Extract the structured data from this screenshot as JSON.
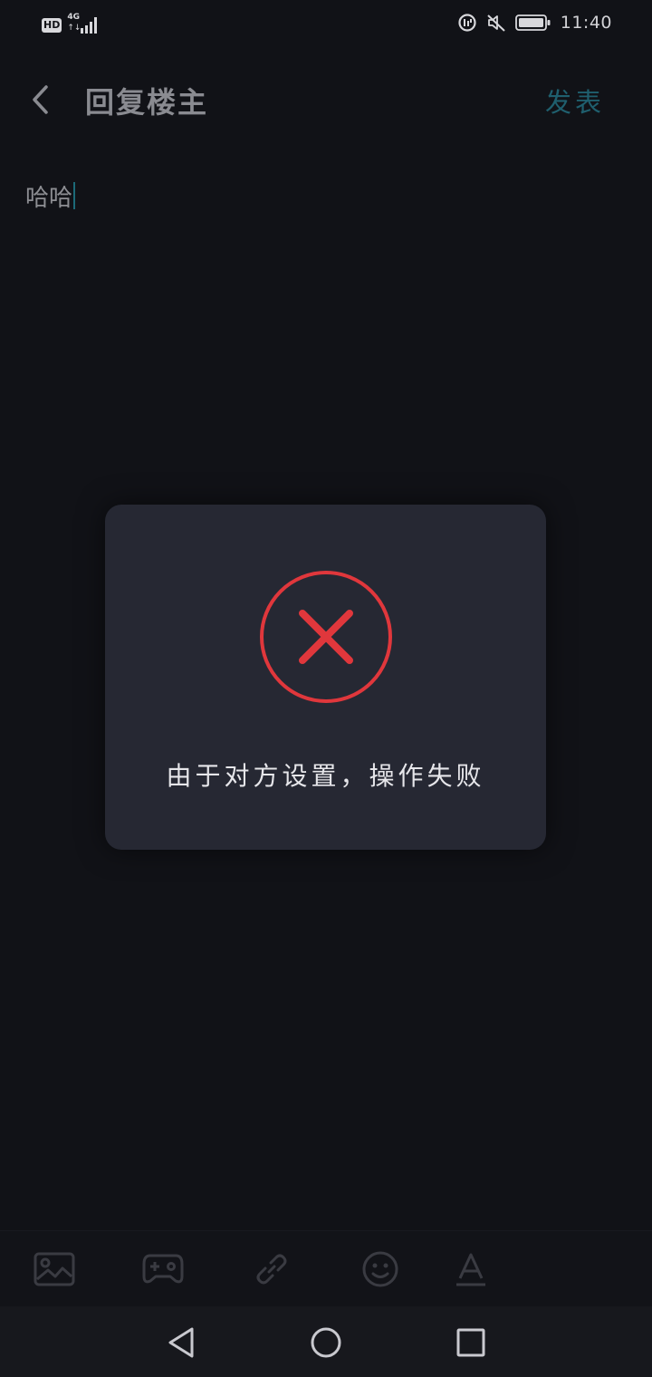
{
  "status_bar": {
    "hd": "HD",
    "network": "4G",
    "network_arrows": "↑↓",
    "time": "11:40",
    "icons": [
      "hd-icon",
      "signal-4g-icon",
      "data-saver-icon",
      "mute-icon",
      "battery-icon"
    ]
  },
  "header": {
    "title": "回复楼主",
    "publish_label": "发表",
    "back_icon": "chevron-left-icon"
  },
  "editor": {
    "text": "哈哈"
  },
  "toast": {
    "message": "由于对方设置，操作失败",
    "icon": "error-x-circle-icon"
  },
  "toolbar": {
    "items": [
      "image-icon",
      "gamepad-icon",
      "link-icon",
      "emoji-icon",
      "text-format-icon"
    ]
  },
  "navbar": {
    "items": [
      "back-triangle-icon",
      "home-circle-icon",
      "recents-square-icon"
    ]
  },
  "colors": {
    "background": "#111217",
    "toast_bg": "#262833",
    "error_red": "#e0373c",
    "accent_teal": "#1f5f6e",
    "title_gray": "#8a8b91"
  }
}
